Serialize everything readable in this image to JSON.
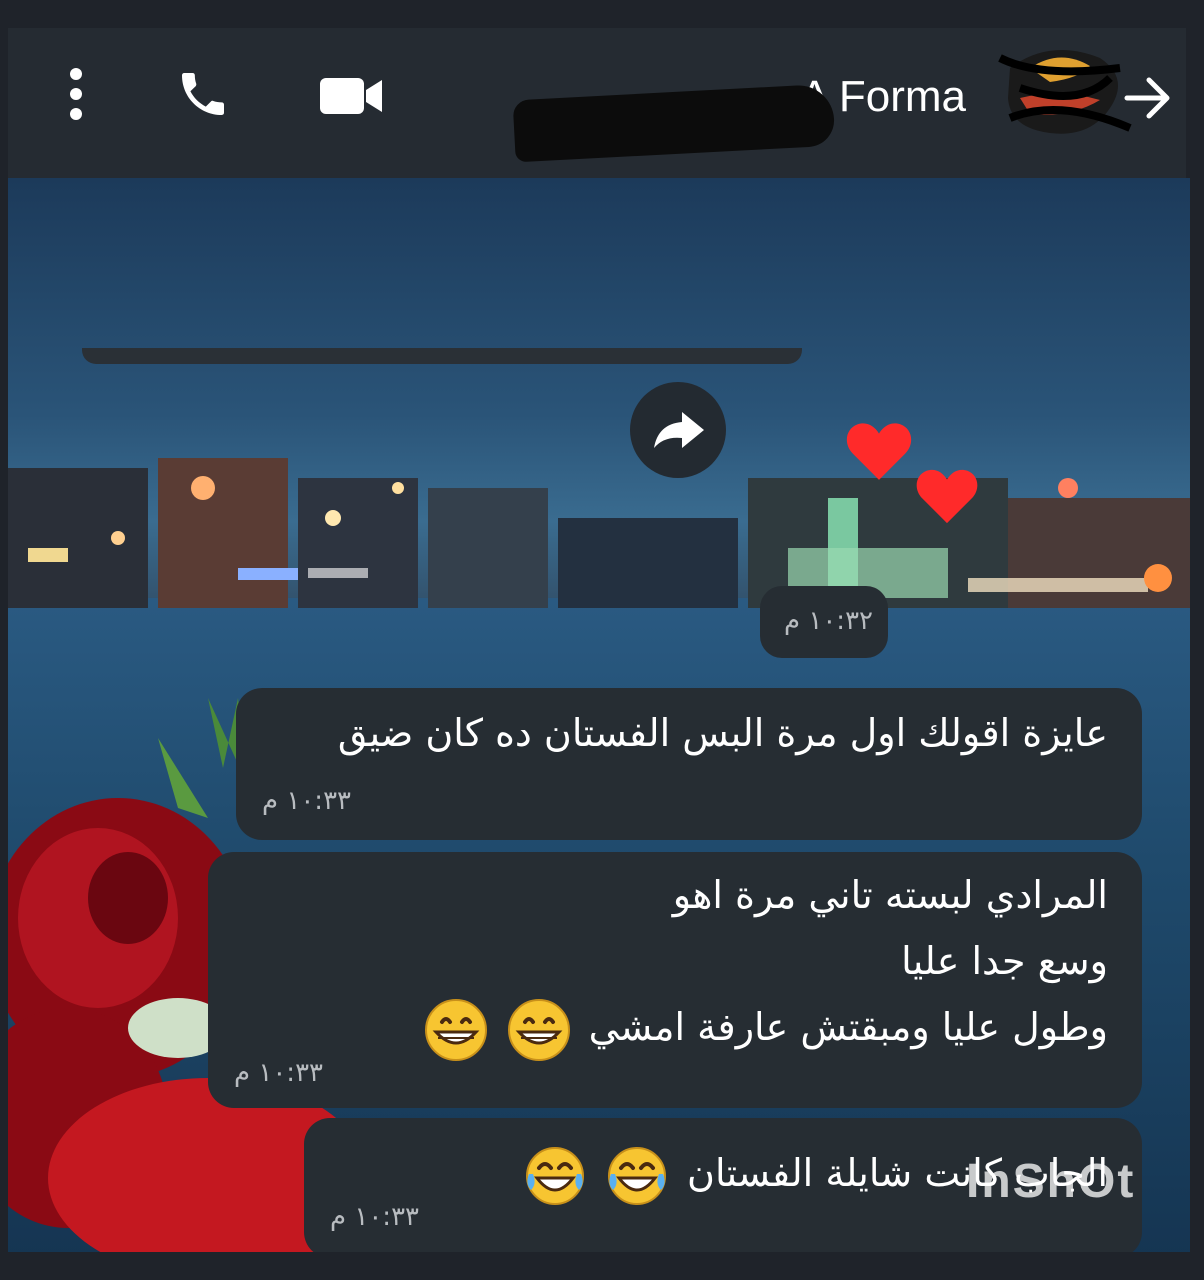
{
  "header": {
    "contact_name": "A  Forma",
    "menu_icon": "more-vert-icon",
    "call_icon": "phone-icon",
    "video_icon": "video-camera-icon",
    "back_icon": "arrow-right-icon"
  },
  "chat": {
    "forward_icon": "share-arrow-icon",
    "hearts": [
      "red-heart-icon",
      "red-heart-icon"
    ],
    "media_time": "١٠:٣٢ م",
    "messages": [
      {
        "lines": [
          "عايزة اقولك اول مرة البس الفستان ده كان ضيق"
        ],
        "time": "١٠:٣٣ م"
      },
      {
        "lines": [
          "المرادي لبسته تاني مرة اهو",
          "وسع جدا عليا",
          "وطول عليا ومبقتش عارفة امشي"
        ],
        "emoji": [
          "grinning-face-icon",
          "grinning-face-icon"
        ],
        "time": "١٠:٣٣ م"
      },
      {
        "lines": [
          "الجاب كانت شايلة الفستان"
        ],
        "emoji": [
          "tears-of-joy-icon",
          "tears-of-joy-icon"
        ],
        "time": "١٠:٣٣ م"
      }
    ]
  },
  "watermark": "InShOt",
  "colors": {
    "bubble": "#262d33",
    "header": "#252b32",
    "heart": "#ff2a2a"
  }
}
